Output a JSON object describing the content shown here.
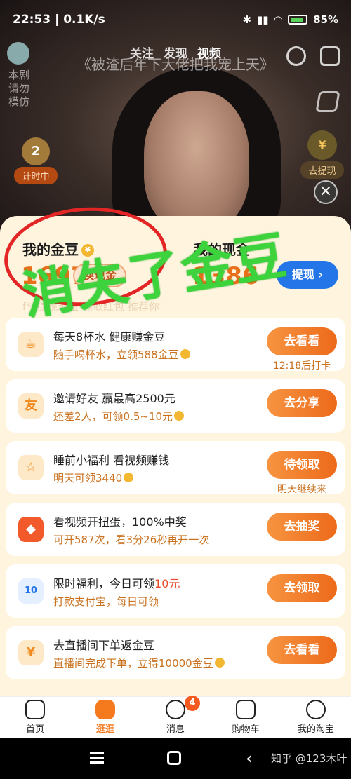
{
  "status_bar": {
    "time": "22:53",
    "speed": "0.1K/s",
    "battery": "85%"
  },
  "video": {
    "top_tabs": [
      "关注",
      "发现",
      "视频"
    ],
    "title": "《被渣后年下大佬把我宠上天》",
    "left_text": "本剧请勿模仿",
    "timer_label": "计时中",
    "timer_badge": "2",
    "withdraw_label": "去提现"
  },
  "balance": {
    "bean_label": "我的金豆",
    "bean_value": "1697",
    "exchange_label": "换现金",
    "cash_label": "我的现金",
    "cash_value": "1386",
    "withdraw_label": "提现",
    "recommend_text": "f**提现现金 领取红包 推荐你"
  },
  "tasks": [
    {
      "title": "每天8杯水 健康赚金豆",
      "sub": "随手喝杯水，立领588金豆",
      "button": "去看看",
      "note": "12:18后打卡",
      "icon": "cup-icon"
    },
    {
      "title": "邀请好友 赢最高2500元",
      "sub": "还差2人，可领0.5~10元",
      "button": "去分享",
      "note": "",
      "icon": "invite-icon"
    },
    {
      "title": "睡前小福利 看视频赚钱",
      "sub": "明天可领3440",
      "button": "待领取",
      "note": "明天继续来",
      "icon": "star-icon"
    },
    {
      "title": "看视频开扭蛋，100%中奖",
      "sub": "可开587次，看3分26秒再开一次",
      "button": "去抽奖",
      "note": "",
      "icon": "gift-icon"
    },
    {
      "title_pre": "限时福利，今日可领",
      "title_hl": "10元",
      "sub": "打款支付宝，每日可领",
      "button": "去领取",
      "note": "",
      "icon": "voucher-icon"
    },
    {
      "title": "去直播间下单返金豆",
      "sub": "直播间完成下单，立得10000金豆",
      "button": "去看看",
      "note": "",
      "icon": "bag-icon"
    }
  ],
  "overlay": {
    "text": "消失了金豆"
  },
  "tabbar": [
    {
      "label": "首页",
      "icon": "home-icon"
    },
    {
      "label": "逛逛",
      "icon": "stroll-icon"
    },
    {
      "label": "消息",
      "icon": "message-icon",
      "badge": "4"
    },
    {
      "label": "购物车",
      "icon": "cart-icon"
    },
    {
      "label": "我的淘宝",
      "icon": "profile-icon"
    }
  ],
  "watermark": "知乎 @123木叶",
  "colors": {
    "accent": "#f57a1e",
    "withdraw_blue": "#2476e8",
    "overlay_green": "#3cd33c",
    "circle_red": "#e32525"
  }
}
